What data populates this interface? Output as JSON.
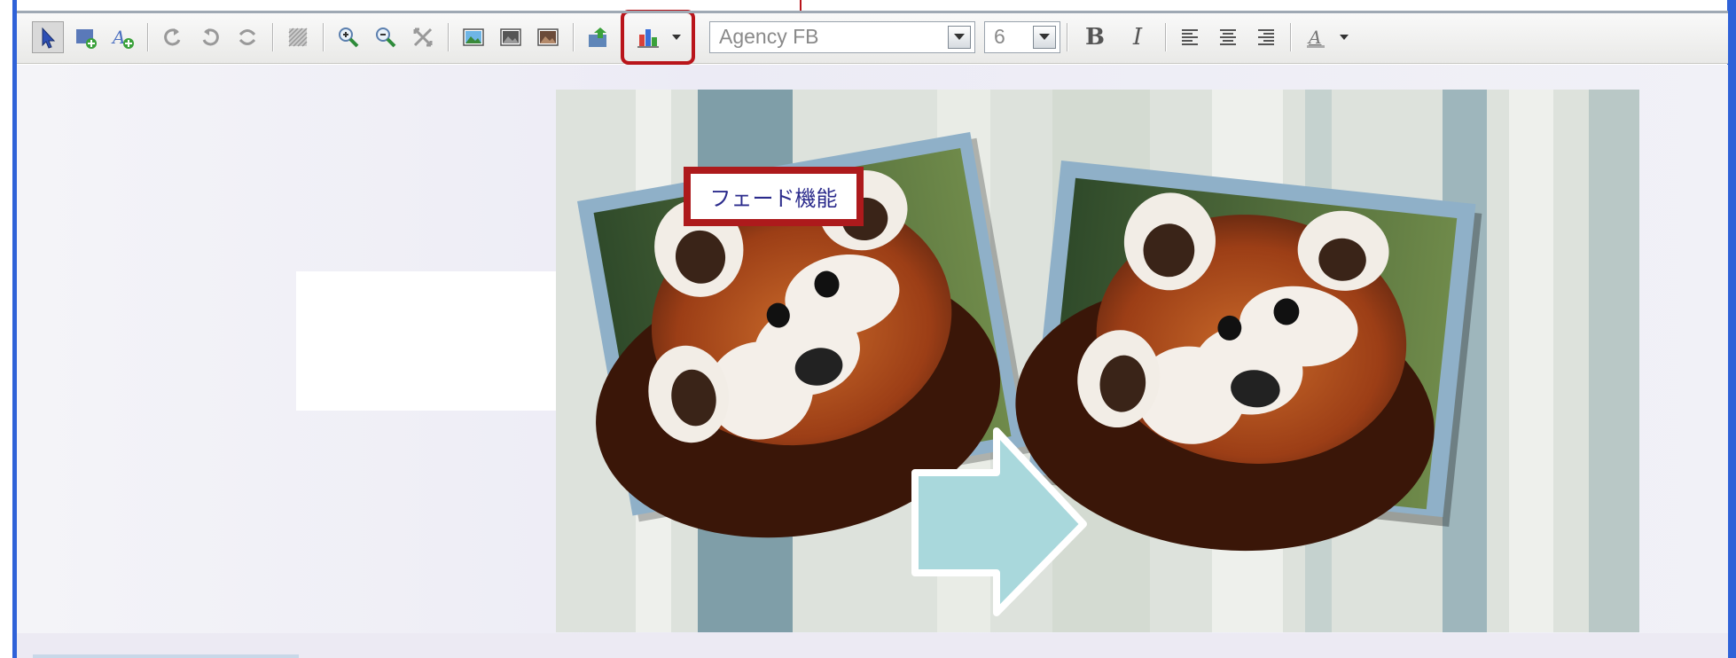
{
  "toolbar": {
    "font_name": "Agency FB",
    "font_size": "6",
    "bold_label": "B",
    "italic_label": "I",
    "accent_color": "#b9151b"
  },
  "slide": {
    "badge_text": "フェード機能",
    "arrow_color": "#a9d8dc",
    "frame_color": "#8fb0c8"
  }
}
